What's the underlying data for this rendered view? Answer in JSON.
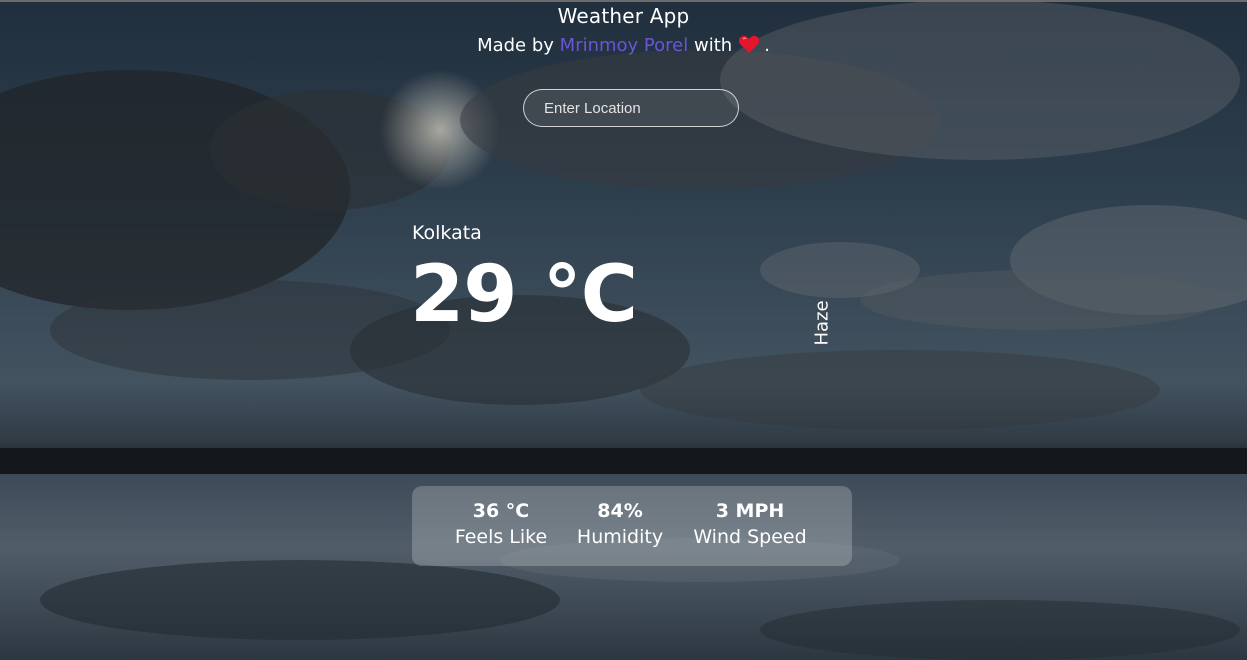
{
  "header": {
    "title": "Weather App",
    "credit_prefix": "Made by",
    "credit_author": "Mrinmoy Porel",
    "credit_with": "with",
    "credit_suffix": ".",
    "heart_icon": "heart-icon"
  },
  "search": {
    "placeholder": "Enter Location",
    "value": ""
  },
  "weather": {
    "city": "Kolkata",
    "temperature": "29 °C",
    "condition": "Haze"
  },
  "stats": [
    {
      "value": "36 °C",
      "label": "Feels Like"
    },
    {
      "value": "84%",
      "label": "Humidity"
    },
    {
      "value": "3 MPH",
      "label": "Wind Speed"
    }
  ],
  "colors": {
    "author_link": "#6b55d6",
    "heart": "#e3162d"
  }
}
